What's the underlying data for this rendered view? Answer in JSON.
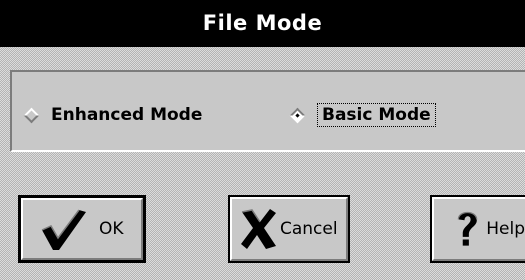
{
  "window": {
    "title": "File Mode"
  },
  "mode_options": [
    {
      "label": "Enhanced Mode",
      "selected": false
    },
    {
      "label": "Basic Mode",
      "selected": true
    }
  ],
  "buttons": {
    "ok": {
      "label": "OK",
      "icon": "checkmark-icon"
    },
    "cancel": {
      "label": "Cancel",
      "icon": "x-icon"
    },
    "help": {
      "label": "Help",
      "icon": "question-mark-icon"
    }
  }
}
